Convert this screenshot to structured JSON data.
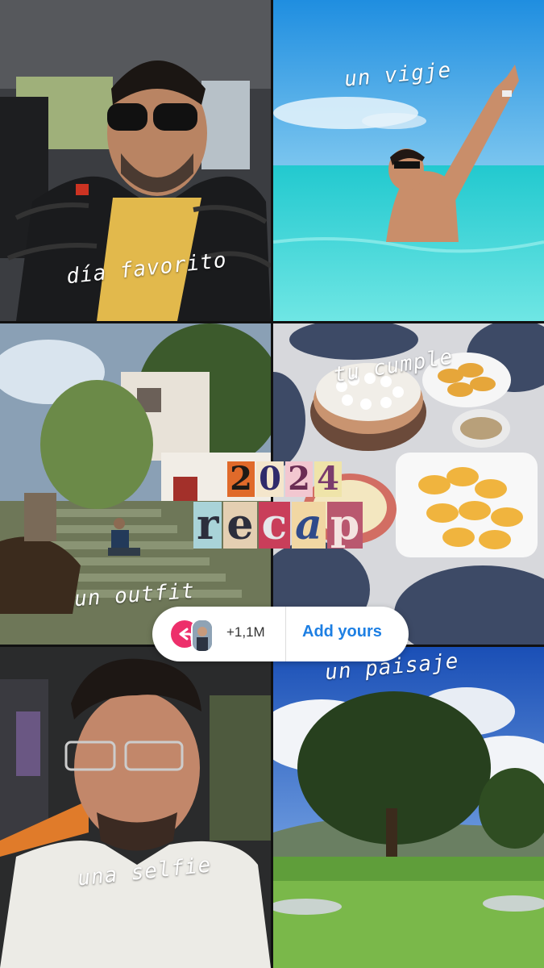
{
  "tiles": [
    {
      "id": "favorite-day",
      "caption": "día favorito"
    },
    {
      "id": "trip",
      "caption": "un vigje"
    },
    {
      "id": "outfit",
      "caption": "un outfit"
    },
    {
      "id": "birthday",
      "caption": "tu cumple"
    },
    {
      "id": "selfie",
      "caption": "una selfie"
    },
    {
      "id": "landscape",
      "caption": "un paisaje"
    }
  ],
  "sticker": {
    "year_chars": [
      "2",
      "0",
      "2",
      "4"
    ],
    "word_chars": [
      "r",
      "e",
      "c",
      "a",
      "p"
    ]
  },
  "add_yours": {
    "count": "+1,1M",
    "label": "Add yours",
    "icons": {
      "left": "reply-arrow-icon",
      "avatar": "participant-avatar"
    }
  },
  "colors": {
    "accent": "#ed2f6b",
    "link": "#1d7fe3"
  }
}
